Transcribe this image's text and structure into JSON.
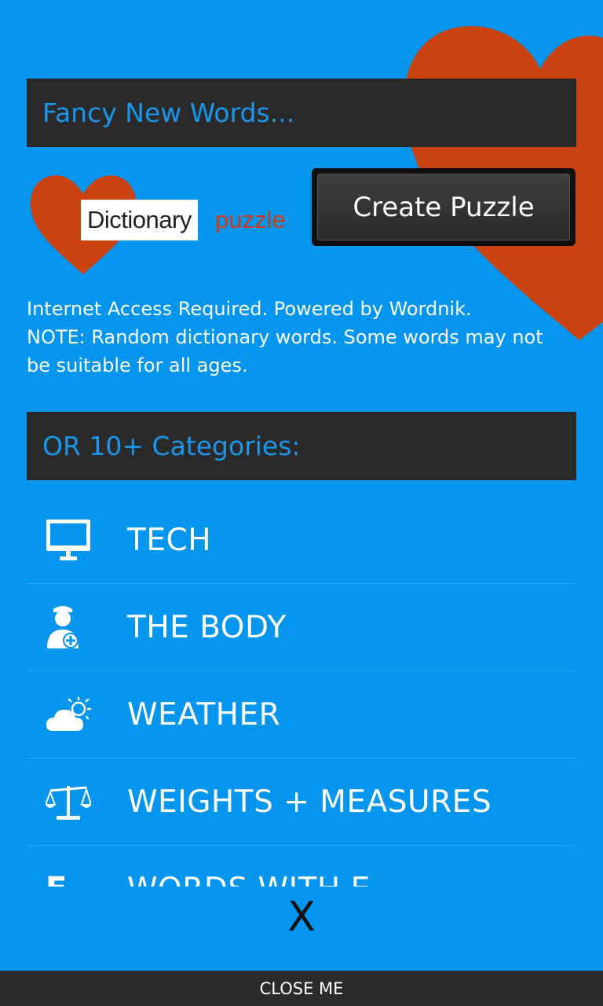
{
  "header": {
    "fancy_title": "Fancy New Words..."
  },
  "logo": {
    "word1": "Dictionary",
    "word2": "puzzle"
  },
  "actions": {
    "create_label": "Create Puzzle"
  },
  "info": {
    "line1": "Internet Access Required. Powered by Wordnik.",
    "line2": "NOTE: Random dictionary words. Some words may not",
    "line3": "be suitable for all ages."
  },
  "categories": {
    "title": "OR 10+ Categories:",
    "items": [
      {
        "label": "TECH",
        "icon": "monitor-icon"
      },
      {
        "label": "THE BODY",
        "icon": "doctor-icon"
      },
      {
        "label": "WEATHER",
        "icon": "cloud-sun-icon"
      },
      {
        "label": "WEIGHTS + MEASURES",
        "icon": "scale-icon"
      },
      {
        "label": "WORDS WITH E",
        "icon": "letter-e-icon"
      }
    ]
  },
  "close": {
    "x_label": "X",
    "bar_label": "CLOSE ME"
  },
  "colors": {
    "background": "#0495ee",
    "heart": "#c9420f",
    "header_bar": "#2a2a2a",
    "header_text": "#1a96ea"
  }
}
